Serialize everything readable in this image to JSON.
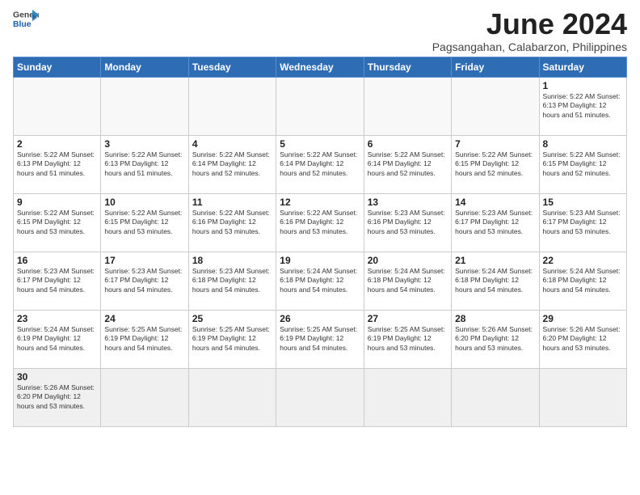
{
  "logo": {
    "line1": "General",
    "line2": "Blue"
  },
  "title": "June 2024",
  "subtitle": "Pagsangahan, Calabarzon, Philippines",
  "days_header": [
    "Sunday",
    "Monday",
    "Tuesday",
    "Wednesday",
    "Thursday",
    "Friday",
    "Saturday"
  ],
  "weeks": [
    [
      {
        "day": "",
        "info": ""
      },
      {
        "day": "",
        "info": ""
      },
      {
        "day": "",
        "info": ""
      },
      {
        "day": "",
        "info": ""
      },
      {
        "day": "",
        "info": ""
      },
      {
        "day": "",
        "info": ""
      },
      {
        "day": "1",
        "info": "Sunrise: 5:22 AM\nSunset: 6:13 PM\nDaylight: 12 hours\nand 51 minutes."
      }
    ],
    [
      {
        "day": "2",
        "info": "Sunrise: 5:22 AM\nSunset: 6:13 PM\nDaylight: 12 hours\nand 51 minutes."
      },
      {
        "day": "3",
        "info": "Sunrise: 5:22 AM\nSunset: 6:13 PM\nDaylight: 12 hours\nand 51 minutes."
      },
      {
        "day": "4",
        "info": "Sunrise: 5:22 AM\nSunset: 6:14 PM\nDaylight: 12 hours\nand 52 minutes."
      },
      {
        "day": "5",
        "info": "Sunrise: 5:22 AM\nSunset: 6:14 PM\nDaylight: 12 hours\nand 52 minutes."
      },
      {
        "day": "6",
        "info": "Sunrise: 5:22 AM\nSunset: 6:14 PM\nDaylight: 12 hours\nand 52 minutes."
      },
      {
        "day": "7",
        "info": "Sunrise: 5:22 AM\nSunset: 6:15 PM\nDaylight: 12 hours\nand 52 minutes."
      },
      {
        "day": "8",
        "info": "Sunrise: 5:22 AM\nSunset: 6:15 PM\nDaylight: 12 hours\nand 52 minutes."
      }
    ],
    [
      {
        "day": "9",
        "info": "Sunrise: 5:22 AM\nSunset: 6:15 PM\nDaylight: 12 hours\nand 53 minutes."
      },
      {
        "day": "10",
        "info": "Sunrise: 5:22 AM\nSunset: 6:15 PM\nDaylight: 12 hours\nand 53 minutes."
      },
      {
        "day": "11",
        "info": "Sunrise: 5:22 AM\nSunset: 6:16 PM\nDaylight: 12 hours\nand 53 minutes."
      },
      {
        "day": "12",
        "info": "Sunrise: 5:22 AM\nSunset: 6:16 PM\nDaylight: 12 hours\nand 53 minutes."
      },
      {
        "day": "13",
        "info": "Sunrise: 5:23 AM\nSunset: 6:16 PM\nDaylight: 12 hours\nand 53 minutes."
      },
      {
        "day": "14",
        "info": "Sunrise: 5:23 AM\nSunset: 6:17 PM\nDaylight: 12 hours\nand 53 minutes."
      },
      {
        "day": "15",
        "info": "Sunrise: 5:23 AM\nSunset: 6:17 PM\nDaylight: 12 hours\nand 53 minutes."
      }
    ],
    [
      {
        "day": "16",
        "info": "Sunrise: 5:23 AM\nSunset: 6:17 PM\nDaylight: 12 hours\nand 54 minutes."
      },
      {
        "day": "17",
        "info": "Sunrise: 5:23 AM\nSunset: 6:17 PM\nDaylight: 12 hours\nand 54 minutes."
      },
      {
        "day": "18",
        "info": "Sunrise: 5:23 AM\nSunset: 6:18 PM\nDaylight: 12 hours\nand 54 minutes."
      },
      {
        "day": "19",
        "info": "Sunrise: 5:24 AM\nSunset: 6:18 PM\nDaylight: 12 hours\nand 54 minutes."
      },
      {
        "day": "20",
        "info": "Sunrise: 5:24 AM\nSunset: 6:18 PM\nDaylight: 12 hours\nand 54 minutes."
      },
      {
        "day": "21",
        "info": "Sunrise: 5:24 AM\nSunset: 6:18 PM\nDaylight: 12 hours\nand 54 minutes."
      },
      {
        "day": "22",
        "info": "Sunrise: 5:24 AM\nSunset: 6:18 PM\nDaylight: 12 hours\nand 54 minutes."
      }
    ],
    [
      {
        "day": "23",
        "info": "Sunrise: 5:24 AM\nSunset: 6:19 PM\nDaylight: 12 hours\nand 54 minutes."
      },
      {
        "day": "24",
        "info": "Sunrise: 5:25 AM\nSunset: 6:19 PM\nDaylight: 12 hours\nand 54 minutes."
      },
      {
        "day": "25",
        "info": "Sunrise: 5:25 AM\nSunset: 6:19 PM\nDaylight: 12 hours\nand 54 minutes."
      },
      {
        "day": "26",
        "info": "Sunrise: 5:25 AM\nSunset: 6:19 PM\nDaylight: 12 hours\nand 54 minutes."
      },
      {
        "day": "27",
        "info": "Sunrise: 5:25 AM\nSunset: 6:19 PM\nDaylight: 12 hours\nand 53 minutes."
      },
      {
        "day": "28",
        "info": "Sunrise: 5:26 AM\nSunset: 6:20 PM\nDaylight: 12 hours\nand 53 minutes."
      },
      {
        "day": "29",
        "info": "Sunrise: 5:26 AM\nSunset: 6:20 PM\nDaylight: 12 hours\nand 53 minutes."
      }
    ],
    [
      {
        "day": "30",
        "info": "Sunrise: 5:26 AM\nSunset: 6:20 PM\nDaylight: 12 hours\nand 53 minutes."
      },
      {
        "day": "",
        "info": ""
      },
      {
        "day": "",
        "info": ""
      },
      {
        "day": "",
        "info": ""
      },
      {
        "day": "",
        "info": ""
      },
      {
        "day": "",
        "info": ""
      },
      {
        "day": "",
        "info": ""
      }
    ]
  ]
}
